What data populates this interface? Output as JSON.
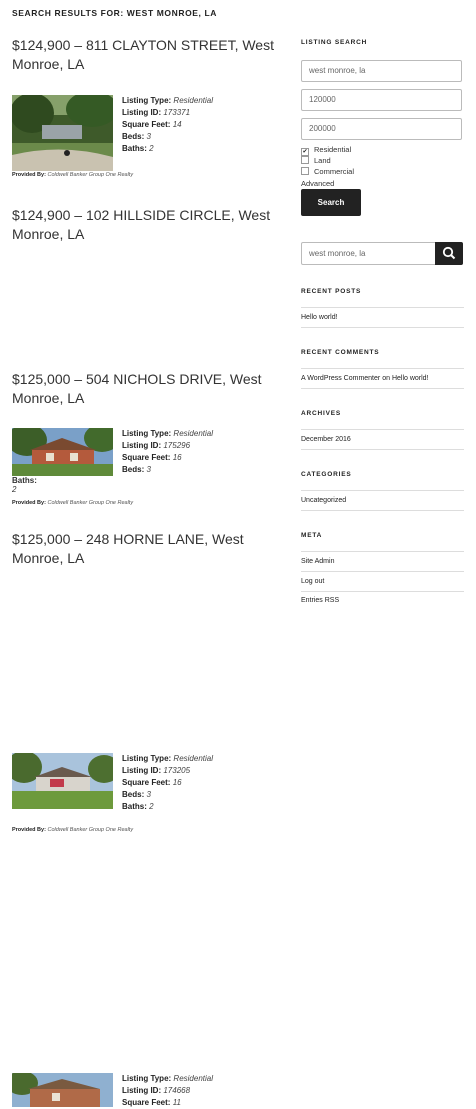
{
  "page": {
    "title": "SEARCH RESULTS FOR: WEST MONROE, LA"
  },
  "listings": [
    {
      "title": "$124,900 – 811 CLAYTON STREET, West Monroe, LA",
      "listing_type_label": "Listing Type:",
      "listing_type": "Residential",
      "listing_id_label": "Listing ID:",
      "listing_id": "173371",
      "sqft_label": "Square Feet:",
      "sqft": "14",
      "beds_label": "Beds:",
      "beds": "3",
      "baths_label": "Baths:",
      "baths": "2",
      "provided_label": "Provided By:",
      "provided_by": "Coldwell Banker Group One Realty"
    },
    {
      "title": "$124,900 – 102 HILLSIDE CIRCLE, West Monroe, LA",
      "listing_type_label": "Listing Type:",
      "listing_type": "Residential",
      "listing_id_label": "Listing ID:",
      "listing_id": "175296",
      "sqft_label": "Square Feet:",
      "sqft": "16",
      "beds_label": "Beds:",
      "beds": "3",
      "baths_label": "Baths:",
      "baths": "2",
      "provided_label": "Provided By:",
      "provided_by": "Coldwell Banker Group One Realty"
    },
    {
      "title": "$125,000 – 504 NICHOLS DRIVE, West Monroe, LA",
      "listing_type_label": "Listing Type:",
      "listing_type": "Residential",
      "listing_id_label": "Listing ID:",
      "listing_id": "173205",
      "sqft_label": "Square Feet:",
      "sqft": "16",
      "beds_label": "Beds:",
      "beds": "3",
      "baths_label": "Baths:",
      "baths": "2",
      "provided_label": "Provided By:",
      "provided_by": "Coldwell Banker Group One Realty"
    },
    {
      "title": "$125,000 – 248 HORNE LANE, West Monroe, LA",
      "listing_type_label": "Listing Type:",
      "listing_type": "Residential",
      "listing_id_label": "Listing ID:",
      "listing_id": "174668",
      "sqft_label": "Square Feet:",
      "sqft": "11"
    }
  ],
  "sidebar": {
    "listing_search": {
      "title": "LISTING SEARCH",
      "location_value": "west monroe, la",
      "min_price_value": "120000",
      "max_price_value": "200000",
      "types": [
        {
          "label": "Residential",
          "checked": true
        },
        {
          "label": "Land",
          "checked": false
        },
        {
          "label": "Commercial",
          "checked": false
        }
      ],
      "advanced_label": "Advanced",
      "search_button": "Search"
    },
    "site_search": {
      "value": "west monroe, la"
    },
    "recent_posts": {
      "title": "RECENT POSTS",
      "items": [
        "Hello world!"
      ]
    },
    "recent_comments": {
      "title": "RECENT COMMENTS",
      "author": "A WordPress Commenter",
      "on": "on",
      "post": "Hello world!"
    },
    "archives": {
      "title": "ARCHIVES",
      "items": [
        "December 2016"
      ]
    },
    "categories": {
      "title": "CATEGORIES",
      "items": [
        "Uncategorized"
      ]
    },
    "meta": {
      "title": "META",
      "items": [
        "Site Admin",
        "Log out",
        "Entries RSS"
      ]
    }
  },
  "colors": {
    "button_bg": "#222222",
    "rule": "#dddddd",
    "text": "#333333"
  }
}
